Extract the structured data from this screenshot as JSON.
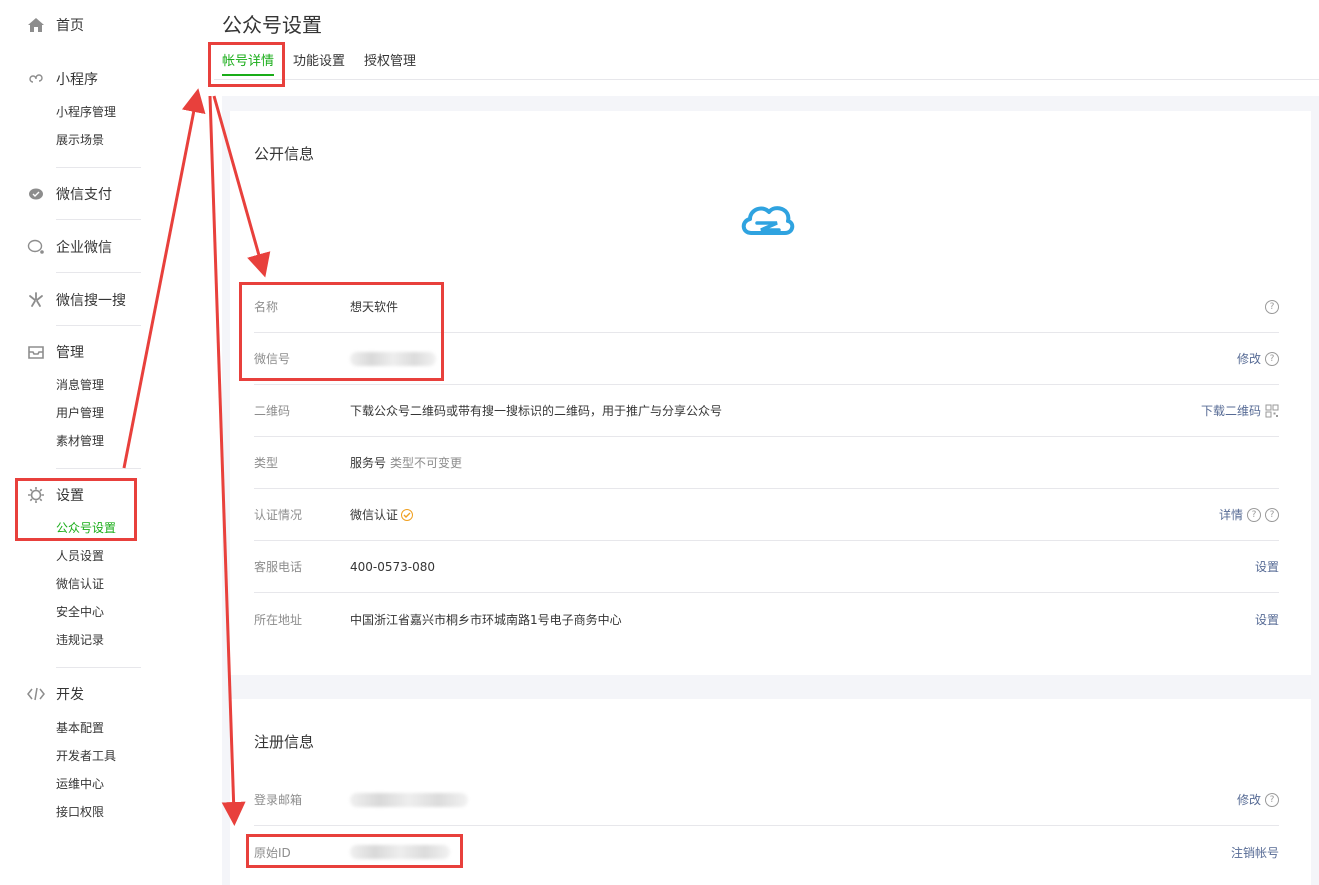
{
  "sidebar": {
    "home": "首页",
    "miniprogram": {
      "label": "小程序",
      "items": [
        "小程序管理",
        "展示场景"
      ]
    },
    "wechat_pay": "微信支付",
    "enterprise_wechat": "企业微信",
    "search": "微信搜一搜",
    "manage": {
      "label": "管理",
      "items": [
        "消息管理",
        "用户管理",
        "素材管理"
      ]
    },
    "settings": {
      "label": "设置",
      "items": [
        "公众号设置",
        "人员设置",
        "微信认证",
        "安全中心",
        "违规记录"
      ]
    },
    "develop": {
      "label": "开发",
      "items": [
        "基本配置",
        "开发者工具",
        "运维中心",
        "接口权限"
      ]
    }
  },
  "page": {
    "title": "公众号设置",
    "tabs": [
      "帐号详情",
      "功能设置",
      "授权管理"
    ]
  },
  "public_info": {
    "title": "公开信息",
    "logo_icon": "cloud-logo-icon",
    "rows": [
      {
        "key": "名称",
        "value": "想天软件",
        "action": ""
      },
      {
        "key": "微信号",
        "value": "",
        "action": "修改"
      },
      {
        "key": "二维码",
        "value": "下载公众号二维码或带有搜一搜标识的二维码，用于推广与分享公众号",
        "action": "下载二维码"
      },
      {
        "key": "类型",
        "value": "服务号",
        "sub": "类型不可变更",
        "action": ""
      },
      {
        "key": "认证情况",
        "value": "微信认证",
        "action": "详情"
      },
      {
        "key": "客服电话",
        "value": "400-0573-080",
        "action": "设置"
      },
      {
        "key": "所在地址",
        "value": "中国浙江省嘉兴市桐乡市环城南路1号电子商务中心",
        "action": "设置"
      }
    ]
  },
  "register_info": {
    "title": "注册信息",
    "rows": [
      {
        "key": "登录邮箱",
        "value": "",
        "action": "修改"
      },
      {
        "key": "原始ID",
        "value": "",
        "action": "注销帐号"
      }
    ]
  },
  "colors": {
    "accent": "#1aad19",
    "link": "#576b95",
    "annotation": "#e8403c"
  }
}
